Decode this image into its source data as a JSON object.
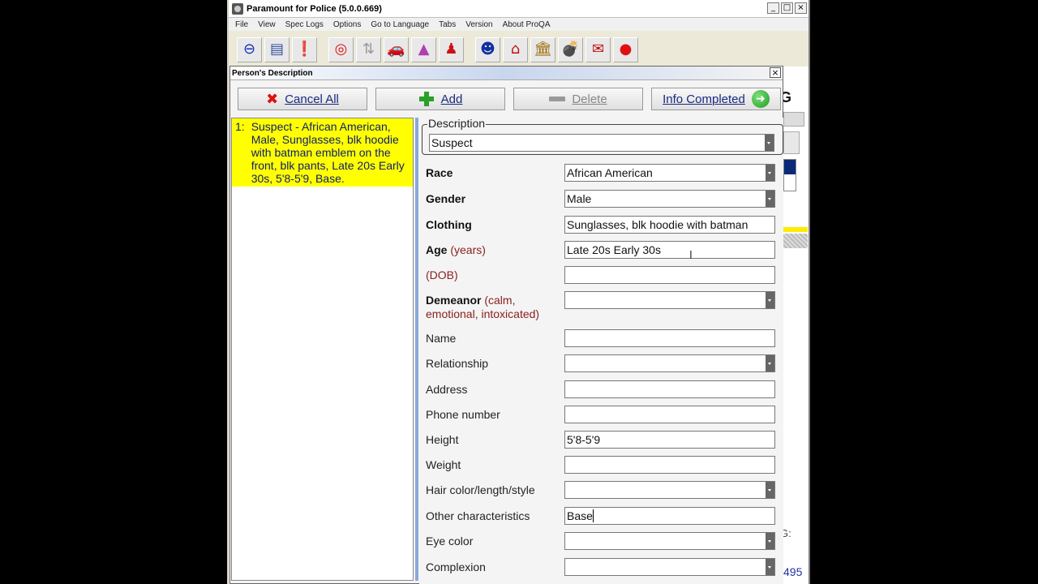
{
  "app": {
    "title": "Paramount for Police (5.0.0.669)",
    "menu": [
      "File",
      "View",
      "Spec Logs",
      "Options",
      "Go to Language",
      "Tabs",
      "Version",
      "About ProQA"
    ],
    "window_controls": {
      "minimize": "_",
      "maximize": "□",
      "close": "×"
    }
  },
  "toolbar": {
    "buttons": [
      {
        "name": "stop-icon",
        "glyph": "⊖",
        "color": "#1030c0"
      },
      {
        "name": "document-icon",
        "glyph": "▤",
        "color": "#3050a0"
      },
      {
        "name": "alert-document-icon",
        "glyph": "❗",
        "color": "#c01010"
      },
      {
        "name": "target-icon",
        "glyph": "◎",
        "color": "#e01010"
      },
      {
        "name": "up-down-arrows-icon",
        "glyph": "⇅",
        "color": "#999999"
      },
      {
        "name": "car-icon",
        "glyph": "🚗",
        "color": "#d01010"
      },
      {
        "name": "cone-icon",
        "glyph": "▲",
        "color": "#b040b0"
      },
      {
        "name": "person-icon",
        "glyph": "♟",
        "color": "#d01010"
      },
      {
        "name": "suspect-face-icon",
        "glyph": "☻",
        "color": "#1030a0"
      },
      {
        "name": "house-icon",
        "glyph": "⌂",
        "color": "#c01010"
      },
      {
        "name": "bank-icon",
        "glyph": "🏛",
        "color": "#a07010"
      },
      {
        "name": "bomb-icon",
        "glyph": "💣",
        "color": "#111111"
      },
      {
        "name": "mail-icon",
        "glyph": "✉",
        "color": "#c01010"
      },
      {
        "name": "record-icon",
        "glyph": "●",
        "color": "#e01010"
      }
    ]
  },
  "dialog": {
    "title": "Person's Description",
    "close": "×",
    "actions": {
      "cancel_all": "Cancel All",
      "add": "Add",
      "delete": "Delete",
      "info_completed": "Info Completed"
    },
    "list": [
      {
        "num": "1:",
        "text": "Suspect - African American, Male, Sunglasses, blk hoodie with batman emblem on the front, blk pants, Late 20s Early 30s, 5'8-5'9, Base."
      }
    ],
    "description": {
      "legend": "Description",
      "value": "Suspect"
    },
    "fields": {
      "race": {
        "label": "Race",
        "value": "African American"
      },
      "gender": {
        "label": "Gender",
        "value": "Male"
      },
      "clothing": {
        "label": "Clothing",
        "value": "Sunglasses, blk hoodie with batman"
      },
      "age": {
        "label": "Age",
        "hint": "(years)",
        "value": "Late 20s Early 30s"
      },
      "dob": {
        "label": "",
        "hint": "(DOB)",
        "value": ""
      },
      "demeanor": {
        "label": "Demeanor",
        "hint": "(calm, emotional, intoxicated)",
        "value": ""
      },
      "name": {
        "label": "Name",
        "value": ""
      },
      "relationship": {
        "label": "Relationship",
        "value": ""
      },
      "address": {
        "label": "Address",
        "value": ""
      },
      "phone": {
        "label": "Phone number",
        "value": ""
      },
      "height": {
        "label": "Height",
        "value": "5'8-5'9"
      },
      "weight": {
        "label": "Weight",
        "value": ""
      },
      "hair": {
        "label": "Hair color/length/style",
        "value": ""
      },
      "other": {
        "label": "Other characteristics",
        "value": "Base"
      },
      "eye": {
        "label": "Eye color",
        "value": ""
      },
      "complexion": {
        "label": "Complexion",
        "value": ""
      }
    }
  },
  "background": {
    "letter": "G",
    "fragment": "G:",
    "number": "495"
  }
}
